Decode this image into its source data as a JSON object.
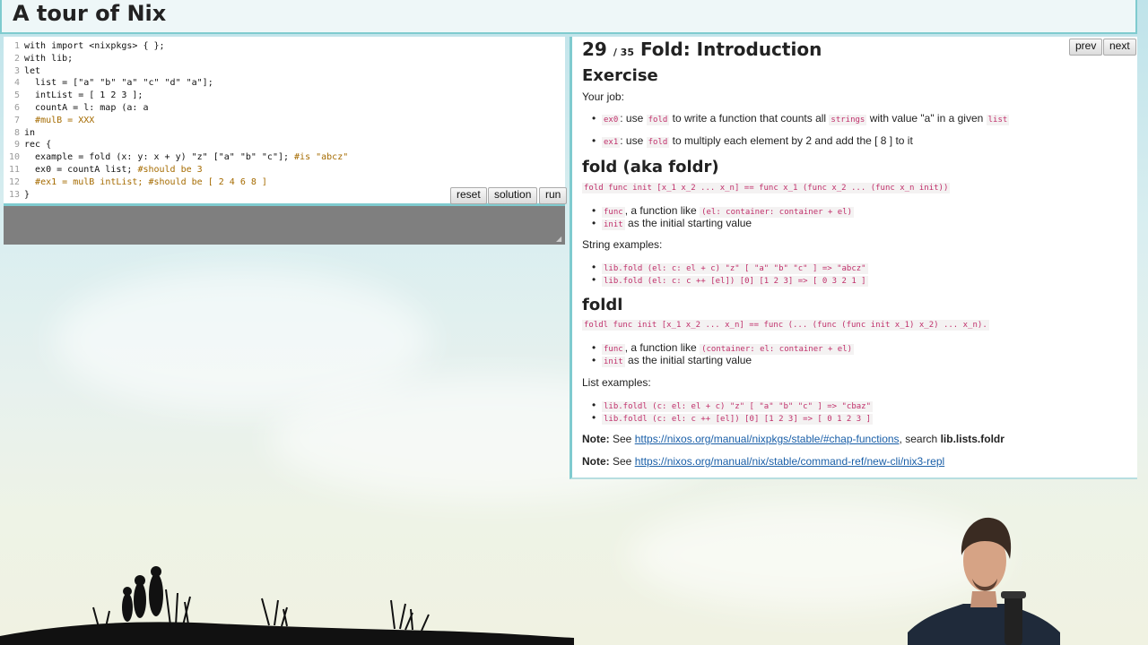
{
  "header": {
    "title": "A tour of Nix"
  },
  "editor": {
    "lines": [
      {
        "n": "1",
        "text": "with import <nixpkgs> { };"
      },
      {
        "n": "2",
        "text": "with lib;"
      },
      {
        "n": "3",
        "text": "let"
      },
      {
        "n": "4",
        "text": "  list = [\"a\" \"b\" \"a\" \"c\" \"d\" \"a\"];"
      },
      {
        "n": "5",
        "text": "  intList = [ 1 2 3 ];"
      },
      {
        "n": "6",
        "text": "  countA = l: map (a: a"
      },
      {
        "n": "7",
        "text": "  #mulB = XXX"
      },
      {
        "n": "8",
        "text": "in"
      },
      {
        "n": "9",
        "text": "rec {"
      },
      {
        "n": "10",
        "text": "  example = fold (x: y: x + y) \"z\" [\"a\" \"b\" \"c\"]; #is \"abcz\""
      },
      {
        "n": "11",
        "text": "  ex0 = countA list; #should be 3"
      },
      {
        "n": "12",
        "text": "  #ex1 = mulB intList; #should be [ 2 4 6 8 ]"
      },
      {
        "n": "13",
        "text": "}"
      }
    ],
    "buttons": {
      "reset": "reset",
      "solution": "solution",
      "run": "run"
    }
  },
  "panel": {
    "lesson_number": "29",
    "lesson_total": "/ 35",
    "lesson_title": "Fold: Introduction",
    "prev": "prev",
    "next": "next",
    "exercise_heading": "Exercise",
    "your_job": "Your job:",
    "ex0": {
      "code": "ex0",
      "t1": ": use ",
      "fold": "fold",
      "t2": " to write a function that counts all ",
      "strings": "strings",
      "t3": " with value \"a\" in a given ",
      "list": "list"
    },
    "ex1": {
      "code": "ex1",
      "t1": ": use ",
      "fold": "fold",
      "t2": " to multiply each element by 2 and add the [ 8 ] to it"
    },
    "fold_heading": "fold (aka foldr)",
    "fold_sig": "fold func init [x_1 x_2 ... x_n] == func x_1 (func x_2 ... (func x_n init))",
    "fold_func": {
      "code": "func",
      "t": ", a function like ",
      "sig": "(el: container: container + el)"
    },
    "fold_init": {
      "code": "init",
      "t": " as the initial starting value"
    },
    "string_examples": "String examples:",
    "str_ex1": "lib.fold (el: c: el + c) \"z\" [ \"a\" \"b\" \"c\" ] => \"abcz\"",
    "str_ex2": "lib.fold (el: c: c ++ [el]) [0] [1 2 3] => [ 0 3 2 1 ]",
    "foldl_heading": "foldl",
    "foldl_sig": "foldl func init [x_1 x_2 ... x_n] == func (... (func (func init x_1) x_2) ... x_n).",
    "foldl_func": {
      "code": "func",
      "t": ", a function like ",
      "sig": "(container: el: container + el)"
    },
    "foldl_init": {
      "code": "init",
      "t": " as the initial starting value"
    },
    "list_examples": "List examples:",
    "list_ex1": "lib.foldl (c: el: el + c) \"z\" [ \"a\" \"b\" \"c\" ] => \"cbaz\"",
    "list_ex2": "lib.foldl (c: el: c ++ [el]) [0] [1 2 3] => [ 0 1 2 3 ]",
    "note1": {
      "label": "Note:",
      "t": " See ",
      "url": "https://nixos.org/manual/nixpkgs/stable/#chap-functions",
      "t2": ", search ",
      "bold": "lib.lists.foldr"
    },
    "note2": {
      "label": "Note:",
      "t": " See ",
      "url": "https://nixos.org/manual/nix/stable/command-ref/new-cli/nix3-repl"
    }
  },
  "colors": {
    "accent": "#7fcbcf",
    "code_pink": "#c0306b",
    "link": "#1a5fa8",
    "output_gray": "#7f7f7f"
  },
  "icons": {
    "resize": "resize-grip-icon"
  }
}
